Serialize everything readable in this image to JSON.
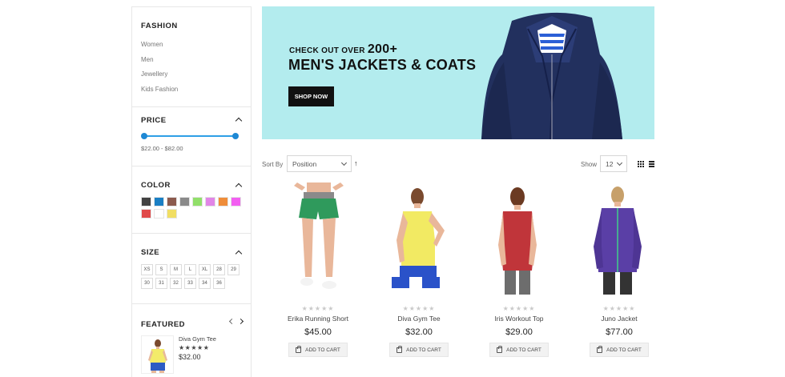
{
  "sidebar": {
    "fashion": {
      "title": "FASHION",
      "categories": [
        "Women",
        "Men",
        "Jewellery",
        "Kids Fashion"
      ]
    },
    "price": {
      "title": "PRICE",
      "range": "$22.00 - $82.00",
      "min_fraction": 0.0,
      "max_fraction": 1.0
    },
    "color": {
      "title": "COLOR",
      "swatches": [
        "#424242",
        "#1a7fc4",
        "#8b5a4e",
        "#8a8a8a",
        "#91df6a",
        "#e186e7",
        "#ef8d3a",
        "#f25ff1",
        "#e04a4a",
        "#ffffff",
        "#f1de63"
      ]
    },
    "size": {
      "title": "SIZE",
      "options": [
        "XS",
        "S",
        "M",
        "L",
        "XL",
        "28",
        "29",
        "30",
        "31",
        "32",
        "33",
        "34",
        "36"
      ]
    },
    "featured": {
      "title": "FEATURED",
      "item": {
        "name": "Diva Gym Tee",
        "stars": "★★★★★",
        "price": "$32.00"
      }
    }
  },
  "banner": {
    "line1": "CHECK OUT OVER",
    "line1_count": "200+",
    "line2": "MEN'S JACKETS & COATS",
    "button": "SHOP NOW",
    "bg_color": "#b3ecee"
  },
  "toolbar": {
    "sort_label": "Sort By",
    "sort_value": "Position",
    "show_label": "Show",
    "show_value": "12"
  },
  "products": [
    {
      "name": "Erika Running Short",
      "price": "$45.00",
      "stars": "★★★★★",
      "cart": "ADD TO CART"
    },
    {
      "name": "Diva Gym Tee",
      "price": "$32.00",
      "stars": "★★★★★",
      "cart": "ADD TO CART"
    },
    {
      "name": "Iris Workout Top",
      "price": "$29.00",
      "stars": "★★★★★",
      "cart": "ADD TO CART"
    },
    {
      "name": "Juno Jacket",
      "price": "$77.00",
      "stars": "★★★★★",
      "cart": "ADD TO CART"
    }
  ]
}
